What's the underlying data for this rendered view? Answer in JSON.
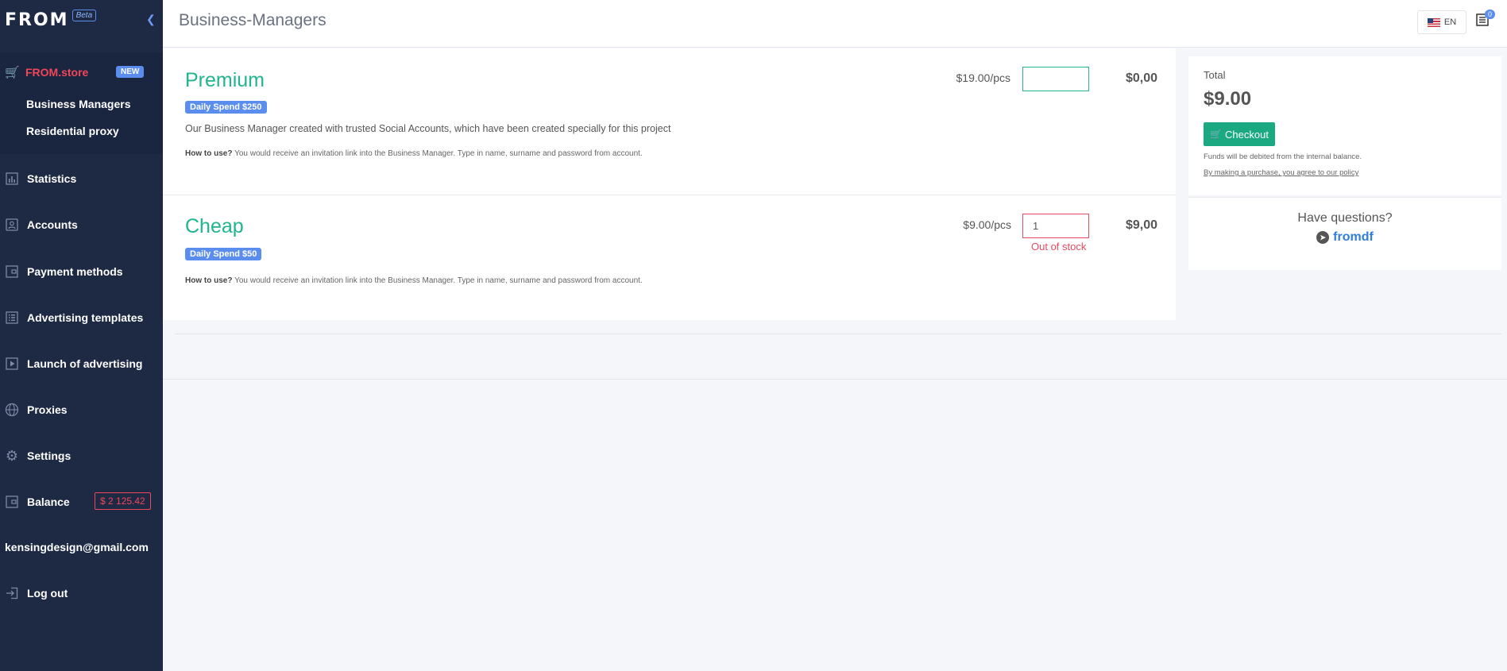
{
  "sidebar": {
    "logo": "FROM",
    "beta": "Beta",
    "store": {
      "label": "FROM.store",
      "badge": "NEW",
      "subitems": [
        "Business Managers",
        "Residential proxy"
      ]
    },
    "items": [
      {
        "label": "Statistics",
        "icon": "bar-chart-icon"
      },
      {
        "label": "Accounts",
        "icon": "user-card-icon"
      },
      {
        "label": "Payment methods",
        "icon": "wallet-icon"
      },
      {
        "label": "Advertising templates",
        "icon": "list-icon"
      },
      {
        "label": "Launch of advertising",
        "icon": "play-icon"
      },
      {
        "label": "Proxies",
        "icon": "globe-icon"
      },
      {
        "label": "Settings",
        "icon": "gear-icon"
      },
      {
        "label": "Balance",
        "icon": "wallet-icon"
      }
    ],
    "balance": "$ 2 125.42",
    "email": "kensingdesign@gmail.com",
    "logout": "Log out"
  },
  "header": {
    "title": "Business-Managers",
    "lang": "EN",
    "cart_count": "0"
  },
  "products": [
    {
      "name": "Premium",
      "tag": "Daily Spend $250",
      "description": "Our Business Manager created with trusted Social Accounts, which have been created specially for this project",
      "howto_label": "How to use?",
      "howto": "You would receive an invitation link into the Business Manager. Type in name, surname and password from account.",
      "price": "$19.00/pcs",
      "qty": "",
      "sum": "$0,00"
    },
    {
      "name": "Cheap",
      "tag": "Daily Spend $50",
      "howto_label": "How to use?",
      "howto": "You would receive an invitation link into the Business Manager. Type in name, surname and password from account.",
      "price": "$9.00/pcs",
      "qty": "1",
      "error": "Out of stock",
      "sum": "$9,00"
    }
  ],
  "total": {
    "label": "Total",
    "value": "$9.00",
    "checkout": "Checkout",
    "note": "Funds will be debited from the internal balance.",
    "policy": "By making a purchase, you agree to our policy"
  },
  "questions": {
    "title": "Have questions?",
    "link": "fromdf"
  }
}
